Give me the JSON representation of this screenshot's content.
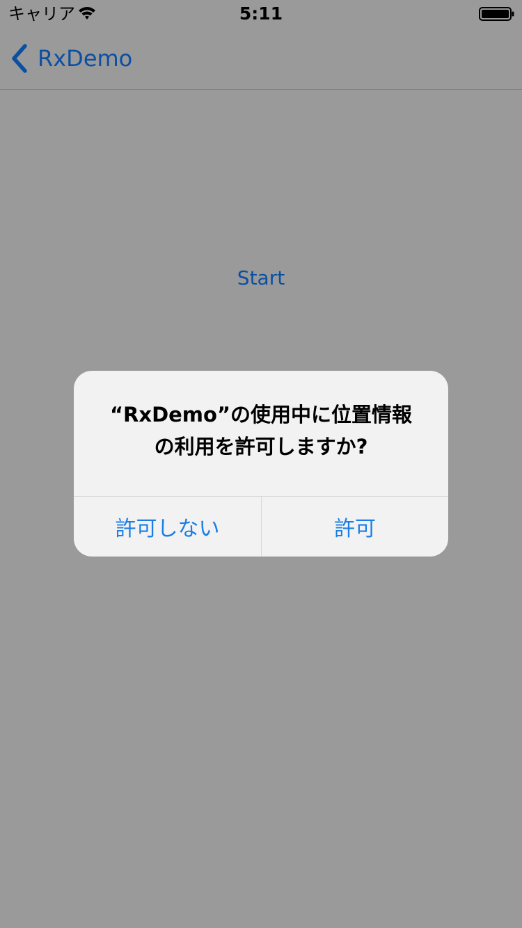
{
  "status_bar": {
    "carrier": "キャリア",
    "time": "5:11",
    "wifi_icon": "wifi-icon",
    "battery_icon": "battery-icon"
  },
  "nav_bar": {
    "back_label": "RxDemo",
    "back_icon": "chevron-left-icon"
  },
  "content": {
    "start_label": "Start"
  },
  "alert": {
    "message_line1": "“RxDemo”の使用中に位置情報",
    "message_line2": "の利用を許可しますか?",
    "deny_label": "許可しない",
    "allow_label": "許可"
  },
  "colors": {
    "overlay_background": "#9a9a9a",
    "link_dimmed": "#0b4fa3",
    "alert_action": "#1a7ee6",
    "alert_background": "#f2f2f2"
  }
}
